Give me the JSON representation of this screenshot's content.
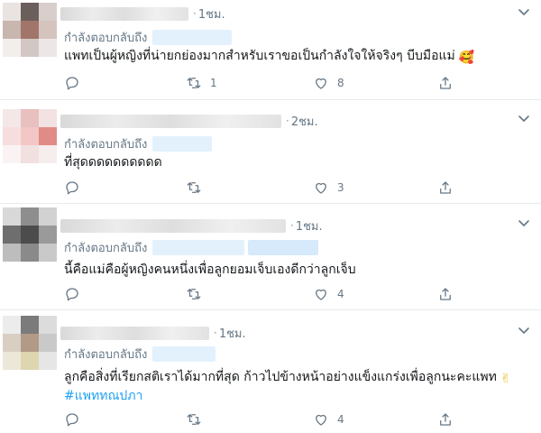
{
  "replying_label": "กำลังตอบกลับถึง",
  "colors": {
    "link": "#1da1f2",
    "muted": "#657786",
    "divider": "#e6ecf0"
  },
  "icons": [
    "chevron-down-icon",
    "reply-icon",
    "retweet-icon",
    "like-icon",
    "share-icon"
  ],
  "tweets": [
    {
      "time": "1ชม.",
      "text": "แพทเป็นผู้หญิงที่น่ายกย่องมากสำหรับเราขอเป็นกำลังใจให้จริงๆ บีบมือแม่",
      "emoji": "🥰",
      "hashtag": "",
      "reply_count": "",
      "retweet_count": "1",
      "like_count": "8"
    },
    {
      "time": "2ชม.",
      "text": "ที่สุดดดดดดดดดด",
      "emoji": "",
      "hashtag": "",
      "reply_count": "",
      "retweet_count": "",
      "like_count": "3"
    },
    {
      "time": "1ชม.",
      "text": "นี้คือแม่คือผู้หญิงคนหนึ่งเพื่อลูกยอมเจ็บเองดีกว่าลูกเจ็บ",
      "emoji": "",
      "hashtag": "",
      "reply_count": "",
      "retweet_count": "",
      "like_count": "4"
    },
    {
      "time": "1ชม.",
      "text": "ลูกคือสิ่งที่เรียกสติเราได้มากที่สุด ก้าวไปข้างหน้าอย่างแข็งแกร่งเพื่อลูกนะคะแพท",
      "emoji": "✌",
      "hashtag": "#แพททณปภา",
      "reply_count": "",
      "retweet_count": "",
      "like_count": "4"
    }
  ]
}
